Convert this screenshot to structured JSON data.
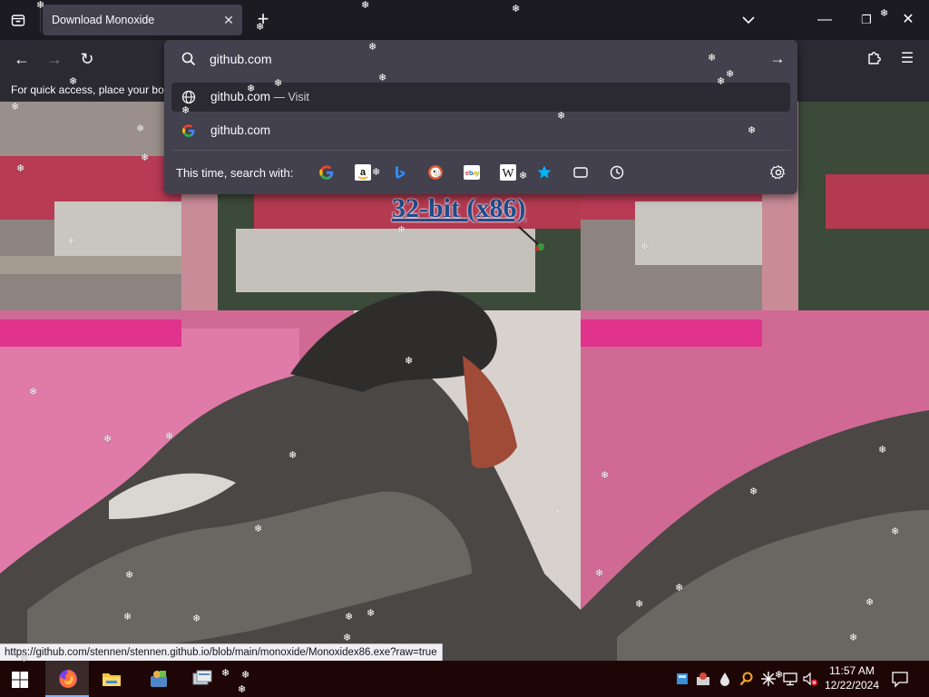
{
  "tabbar": {
    "tab_title": "Download Monoxide",
    "close_glyph": "✕",
    "new_tab_glyph": "+",
    "list_tabs_icon": "chevron-down-icon",
    "window_controls": {
      "minimize": "—",
      "maximize": "❐",
      "close": "✕"
    }
  },
  "navbar": {
    "back_glyph": "←",
    "forward_glyph": "→",
    "reload_glyph": "↻",
    "extensions_icon": "puzzle-icon",
    "menu_glyph": "☰"
  },
  "bookmarks": {
    "prompt": "For quick access, place your bookmarks here on the bookmarks toolbar."
  },
  "urlbar": {
    "value": "github.com",
    "go_glyph": "→",
    "suggestions": [
      {
        "icon": "globe-icon",
        "text": "github.com",
        "suffix": " — Visit"
      },
      {
        "icon": "google-icon",
        "text": "github.com",
        "suffix": ""
      }
    ],
    "engines_label": "This time, search with:",
    "engines": [
      "google-icon",
      "amazon-icon",
      "bing-icon",
      "duckduckgo-icon",
      "ebay-icon",
      "wikipedia-icon",
      "bookmarks-star-icon",
      "tabs-icon",
      "history-icon"
    ],
    "settings_icon": "gear-icon"
  },
  "page": {
    "download_link": "32-bit (x86)"
  },
  "status": {
    "url": "https://github.com/stennen/stennen.github.io/blob/main/monoxide/Monoxidex86.exe?raw=true"
  },
  "taskbar": {
    "apps": [
      "firefox-icon",
      "file-explorer-icon",
      "app-icon",
      "app-icon"
    ],
    "time": "11:57 AM",
    "date": "12/22/2024"
  },
  "snow_glyph": "❄",
  "colors": {
    "accent": "#7fb2ff",
    "link": "#1e4c8c",
    "tab_active": "#42414d",
    "toolbar": "#2b2a33"
  }
}
